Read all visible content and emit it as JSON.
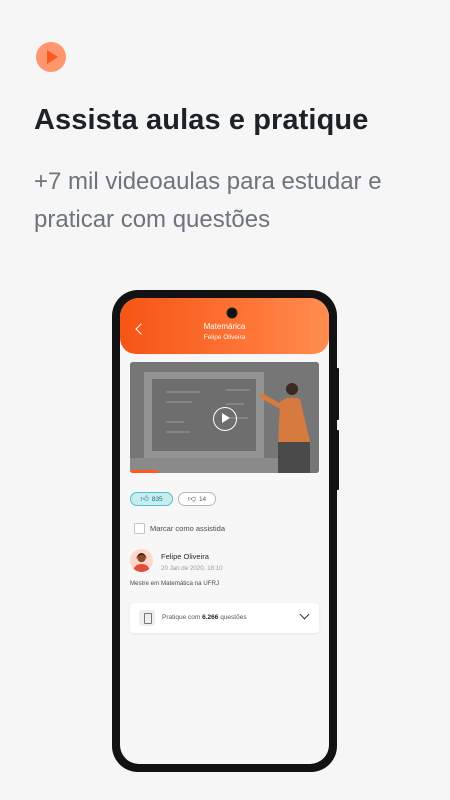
{
  "intro": {
    "title": "Assista aulas e pratique",
    "subtitle": "+7 mil videoaulas para estudar e praticar com questões"
  },
  "colors": {
    "accent": "#fb5a1e",
    "accent_light": "#ff9670",
    "like_bg": "#c7edf1",
    "like_border": "#52bfcc"
  },
  "app": {
    "header": {
      "title": "Matemárica",
      "subtitle": "Felipe Oliveira"
    },
    "video": {
      "progress": 0.15
    },
    "likes": "835",
    "dislikes": "14",
    "mark_watched_label": "Marcar como assistida",
    "teacher": {
      "name": "Felipe Oliveira",
      "date": "20 Jan de 2020, 18:10",
      "bio": "Mestre em Matemática na UFRJ"
    },
    "practice": {
      "prefix": "Pratique com",
      "count": "6.266",
      "suffix": "questões"
    }
  }
}
